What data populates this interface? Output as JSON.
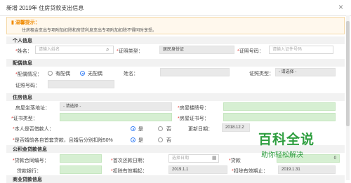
{
  "window": {
    "title": "新增 2019年 住房贷款支出信息",
    "close": "×"
  },
  "tip": {
    "title": "温馨提示：",
    "text": "住房租金支出专项附加扣除和房贷利息支出专项附加扣除不得同时享受。"
  },
  "personal": {
    "section": "个人信息",
    "name_label": "姓名：",
    "name_placeholder": "请输入姓名",
    "id_type_label": "证照类型：",
    "id_type_value": "居民身份证",
    "id_no_label": "证照号码：",
    "id_no_placeholder": "请输入证件号码"
  },
  "spouse": {
    "section": "配偶信息",
    "status_label": "配偶情况：",
    "opt_has": "有配偶",
    "opt_none": "无配偶",
    "name_label": "姓名：",
    "id_type_label": "证照类型：",
    "id_type_placeholder": "- 请选择 -",
    "id_no_label": "证照号码："
  },
  "housing": {
    "section": "住房信息",
    "addr_label": "房屋坐落地址：",
    "addr_placeholder": "- 请选择 -",
    "cert_no_label": "房屋楼牌号：",
    "cert_type_label": "证书类型：",
    "house_cert_label": "房屋证书号：",
    "borrower_label": "本人是否借款人：",
    "yes": "是",
    "no": "否",
    "update_label": "更新日期：",
    "update_value": "2018.12.2",
    "pre_marriage_label": "是否婚前各自首套贷款，且婚后分别扣除50%",
    "yes2": "是",
    "no2": "否"
  },
  "fund_loan": {
    "section": "公积金贷款信息",
    "contract_label": "贷款合同编号：",
    "first_repay_label": "首次还款日期：",
    "first_repay_placeholder": "选择日期",
    "term_label": "贷款",
    "term_value": "0",
    "bank_label": "贷款银行：",
    "start_label": "扣除有效期起：",
    "start_value": "2019.1.1",
    "end_label": "扣除有效期止：",
    "end_value": "2019.1.31"
  },
  "commercial_loan": {
    "section": "商业贷款信息"
  },
  "watermark": {
    "big": "百科全说",
    "small": "助你轻松解决"
  }
}
